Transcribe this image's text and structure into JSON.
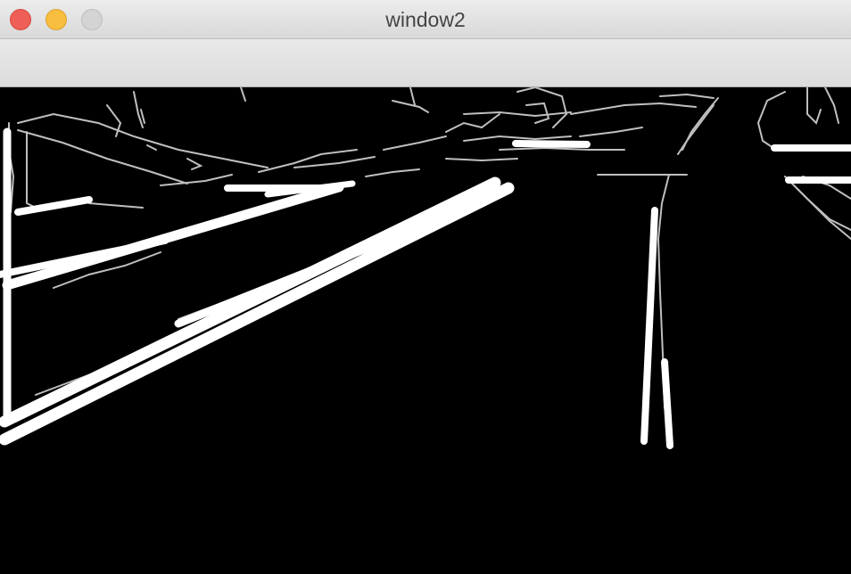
{
  "window": {
    "title": "window2"
  },
  "colors": {
    "titlebar": "#e0e0e0",
    "close": "#ee5f57",
    "minimize": "#f7be3f",
    "zoom": "#d4d4d4",
    "image_background": "#000000",
    "edge_lines": "#ffffff"
  },
  "icons": {
    "close": "close-button-icon",
    "minimize": "minimize-button-icon",
    "zoom": "zoom-button-icon"
  },
  "image": {
    "description_kind": "edge-detection-output"
  }
}
